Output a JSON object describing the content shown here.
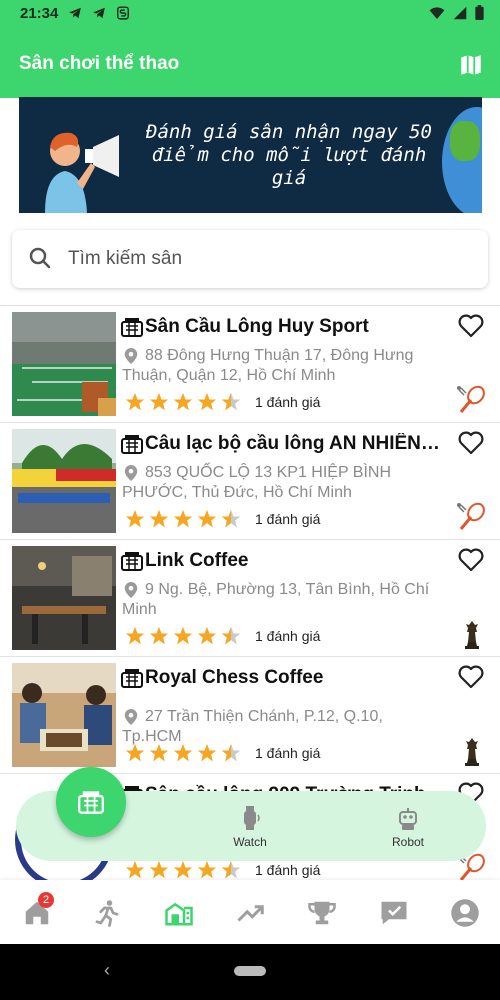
{
  "status_bar": {
    "time": "21:34",
    "left_icons": [
      "telegram-icon",
      "telegram-icon",
      "app-s-icon"
    ],
    "right_icons": [
      "wifi-icon",
      "signal-icon",
      "battery-icon"
    ]
  },
  "app_bar": {
    "title": "Sân chơi thể thao",
    "map_icon": "map-icon",
    "color": "#3dd56d"
  },
  "banner": {
    "text": "Đánh giá sân nhận ngay 50 điểm cho mỗi lượt đánh giá"
  },
  "search": {
    "placeholder": "Tìm kiếm sân"
  },
  "venues": [
    {
      "name": "Sân Cầu Lông Huy Sport",
      "address": "88 Đông Hưng Thuận 17, Đông Hưng Thuận, Quận 12, Hồ Chí Minh",
      "rating_text": "1 đánh giá",
      "stars": 4.5,
      "sport_icon": "badminton-icon"
    },
    {
      "name": "Câu lạc bộ cầu lông AN NHIÊN SPORT",
      "address": "853 QUỐC LỘ 13 KP1 HIỆP BÌNH PHƯỚC, Thủ Đức, Hồ Chí Minh",
      "rating_text": "1 đánh giá",
      "stars": 4.5,
      "sport_icon": "badminton-icon"
    },
    {
      "name": "Link Coffee",
      "address": "9 Ng. Bệ, Phường 13, Tân Bình, Hồ Chí Minh",
      "rating_text": "1 đánh giá",
      "stars": 4.5,
      "sport_icon": "chess-icon"
    },
    {
      "name": "Royal Chess Coffee",
      "address": "27 Trần Thiện Chánh, P.12, Q.10, Tp.HCM",
      "rating_text": "1 đánh giá",
      "stars": 4.5,
      "sport_icon": "chess-icon"
    },
    {
      "name": "Sân cầu lông 909 Trường Trinh",
      "address": "",
      "rating_text": "1 đánh giá",
      "stars": 4.5,
      "sport_icon": "badminton-icon"
    }
  ],
  "fab_menu": {
    "watch_label": "Watch",
    "robot_label": "Robot"
  },
  "bottom_nav": {
    "badge_count": "2",
    "items": [
      "home-icon",
      "run-icon",
      "venue-icon",
      "trending-icon",
      "trophy-icon",
      "chat-check-icon",
      "account-icon"
    ]
  },
  "colors": {
    "accent": "#3dd56d",
    "star": "#f5a623",
    "fab_bar": "#d5f5df"
  }
}
